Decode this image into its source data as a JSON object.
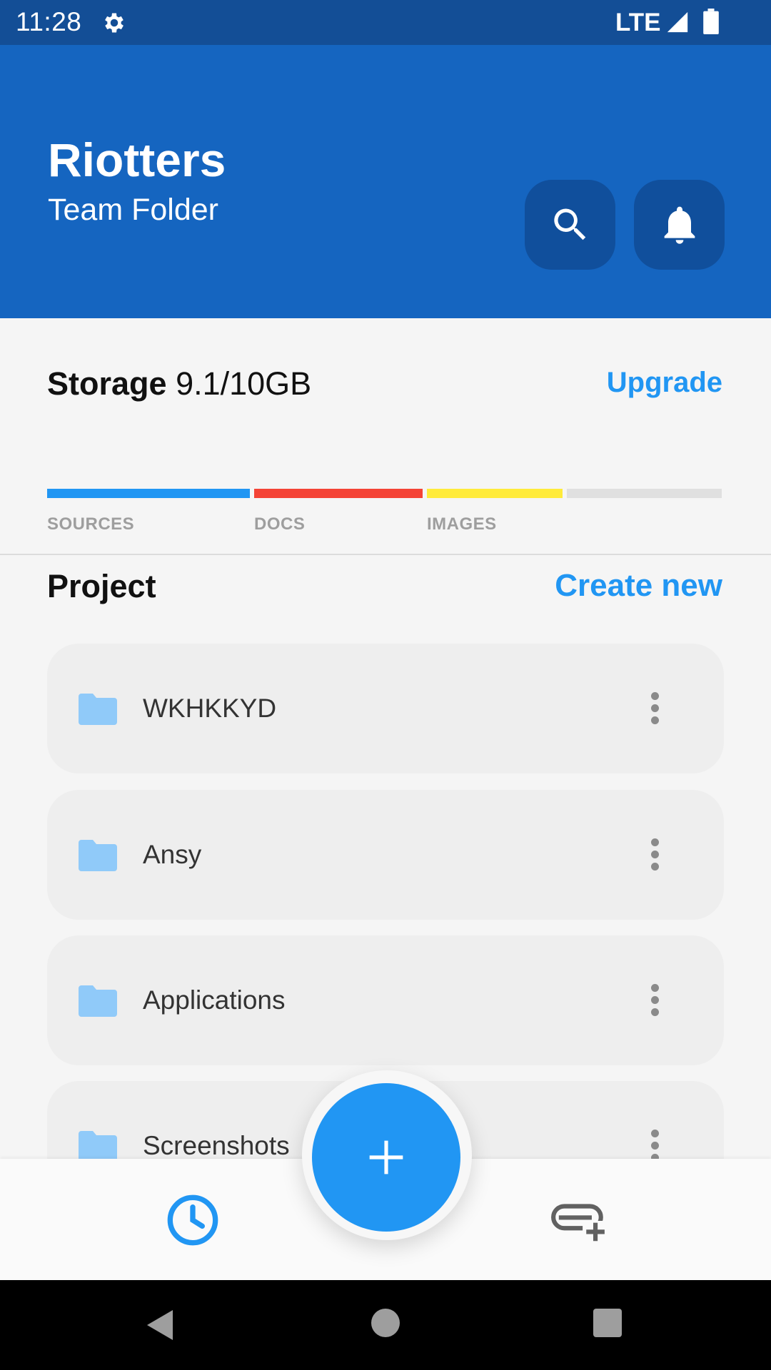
{
  "status_bar": {
    "time": "11:28",
    "network": "LTE",
    "icons": [
      "gear-icon",
      "signal-icon",
      "battery-icon"
    ]
  },
  "header": {
    "title": "Riotters",
    "subtitle": "Team Folder",
    "buttons": [
      "search-icon",
      "bell-icon"
    ],
    "color": "#1565c0"
  },
  "storage": {
    "label": "Storage",
    "value": "9.1/10GB",
    "upgrade_label": "Upgrade",
    "categories": [
      {
        "label": "SOURCES",
        "color": "#2196f3"
      },
      {
        "label": "DOCS",
        "color": "#f44336"
      },
      {
        "label": "IMAGES",
        "color": "#ffeb3b"
      }
    ]
  },
  "project": {
    "title": "Project",
    "create_label": "Create new",
    "folders": [
      {
        "name": "WKHKKYD"
      },
      {
        "name": "Ansy"
      },
      {
        "name": "Applications"
      },
      {
        "name": "Screenshots"
      }
    ]
  },
  "bottom_nav": {
    "items": [
      "history-icon",
      "add-icon",
      "add-to-queue-icon"
    ],
    "accent": "#2196f3"
  },
  "system_nav": {
    "items": [
      "back-icon",
      "home-icon",
      "recents-icon"
    ]
  }
}
